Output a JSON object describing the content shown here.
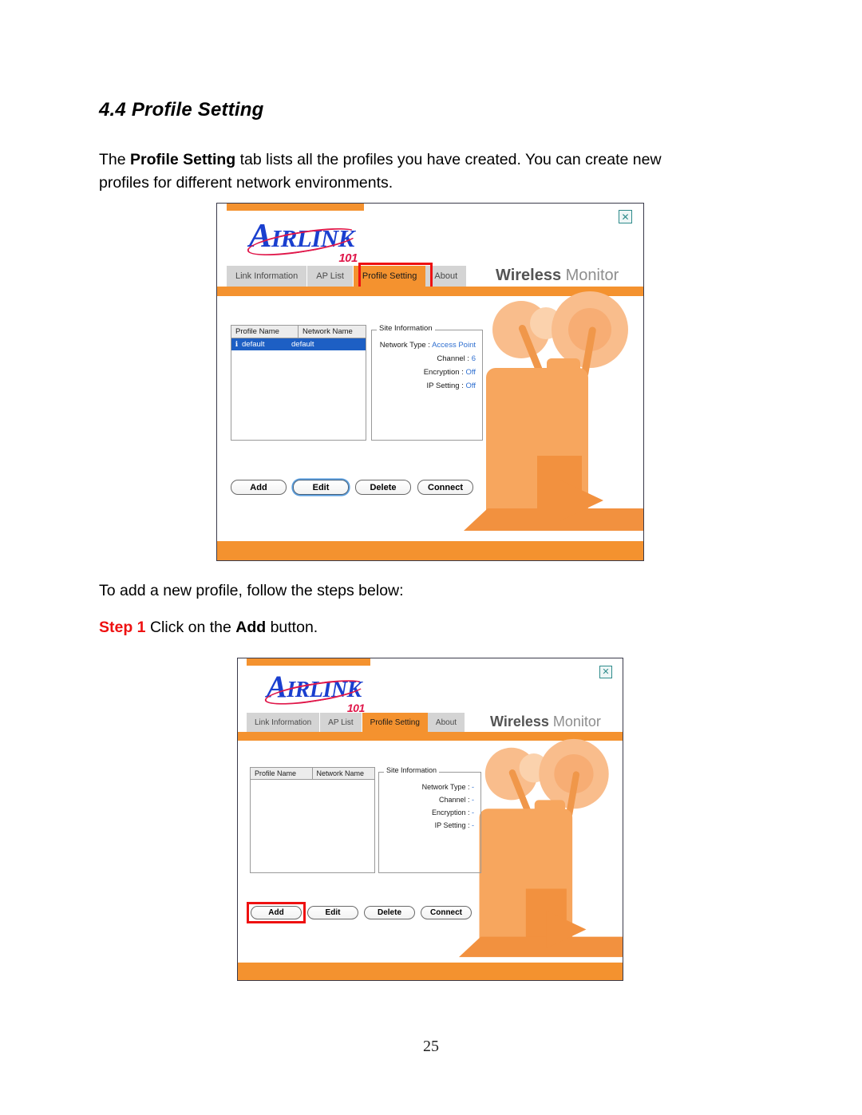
{
  "document": {
    "heading": "4.4 Profile Setting",
    "intro_prefix": "The ",
    "intro_bold": "Profile Setting",
    "intro_suffix": " tab lists all the profiles you have created. You can create new profiles for different network environments.",
    "followup": "To add a new profile, follow the steps below:",
    "step_label": "Step 1",
    "step_prefix": " Click on the ",
    "step_bold": "Add",
    "step_suffix": " button.",
    "page_number": "25"
  },
  "app": {
    "logo": {
      "cap": "A",
      "rest": "IRL",
      "rest2": "INK",
      "suffix": "101"
    },
    "brand": {
      "bold": "Wireless",
      "light": " Monitor"
    },
    "close_icon": "✕",
    "tabs": [
      {
        "label": "Link Information"
      },
      {
        "label": "AP List"
      },
      {
        "label": "Profile Setting"
      },
      {
        "label": "About"
      }
    ],
    "list_columns": [
      "Profile Name",
      "Network Name"
    ],
    "site_info_legend": "Site Information",
    "buttons": [
      "Add",
      "Edit",
      "Delete",
      "Connect"
    ]
  },
  "window_one": {
    "active_tab": "Profile Setting",
    "rows": [
      {
        "icon": "ℹ",
        "profile_name": "default",
        "network_name": "default"
      }
    ],
    "site_info": [
      {
        "label": "Network Type : ",
        "value": "Access Point"
      },
      {
        "label": "Channel : ",
        "value": "6"
      },
      {
        "label": "Encryption : ",
        "value": "Off"
      },
      {
        "label": "IP Setting : ",
        "value": "Off"
      }
    ],
    "focused_button": "Edit",
    "highlighted_element": "Profile Setting tab"
  },
  "window_two": {
    "active_tab": "Profile Setting",
    "rows": [],
    "site_info": [
      {
        "label": "Network Type : ",
        "value": "-"
      },
      {
        "label": "Channel : ",
        "value": "-"
      },
      {
        "label": "Encryption : ",
        "value": "-"
      },
      {
        "label": "IP Setting : ",
        "value": "-"
      }
    ],
    "focused_button": "",
    "highlighted_element": "Add button"
  },
  "colors": {
    "accent_orange": "#f4922f",
    "highlight_red": "#ee1111",
    "selection_blue": "#1d5fc4",
    "value_blue": "#2f6fd0",
    "logo_blue": "#1a3fcf",
    "logo_red": "#e0174a"
  }
}
